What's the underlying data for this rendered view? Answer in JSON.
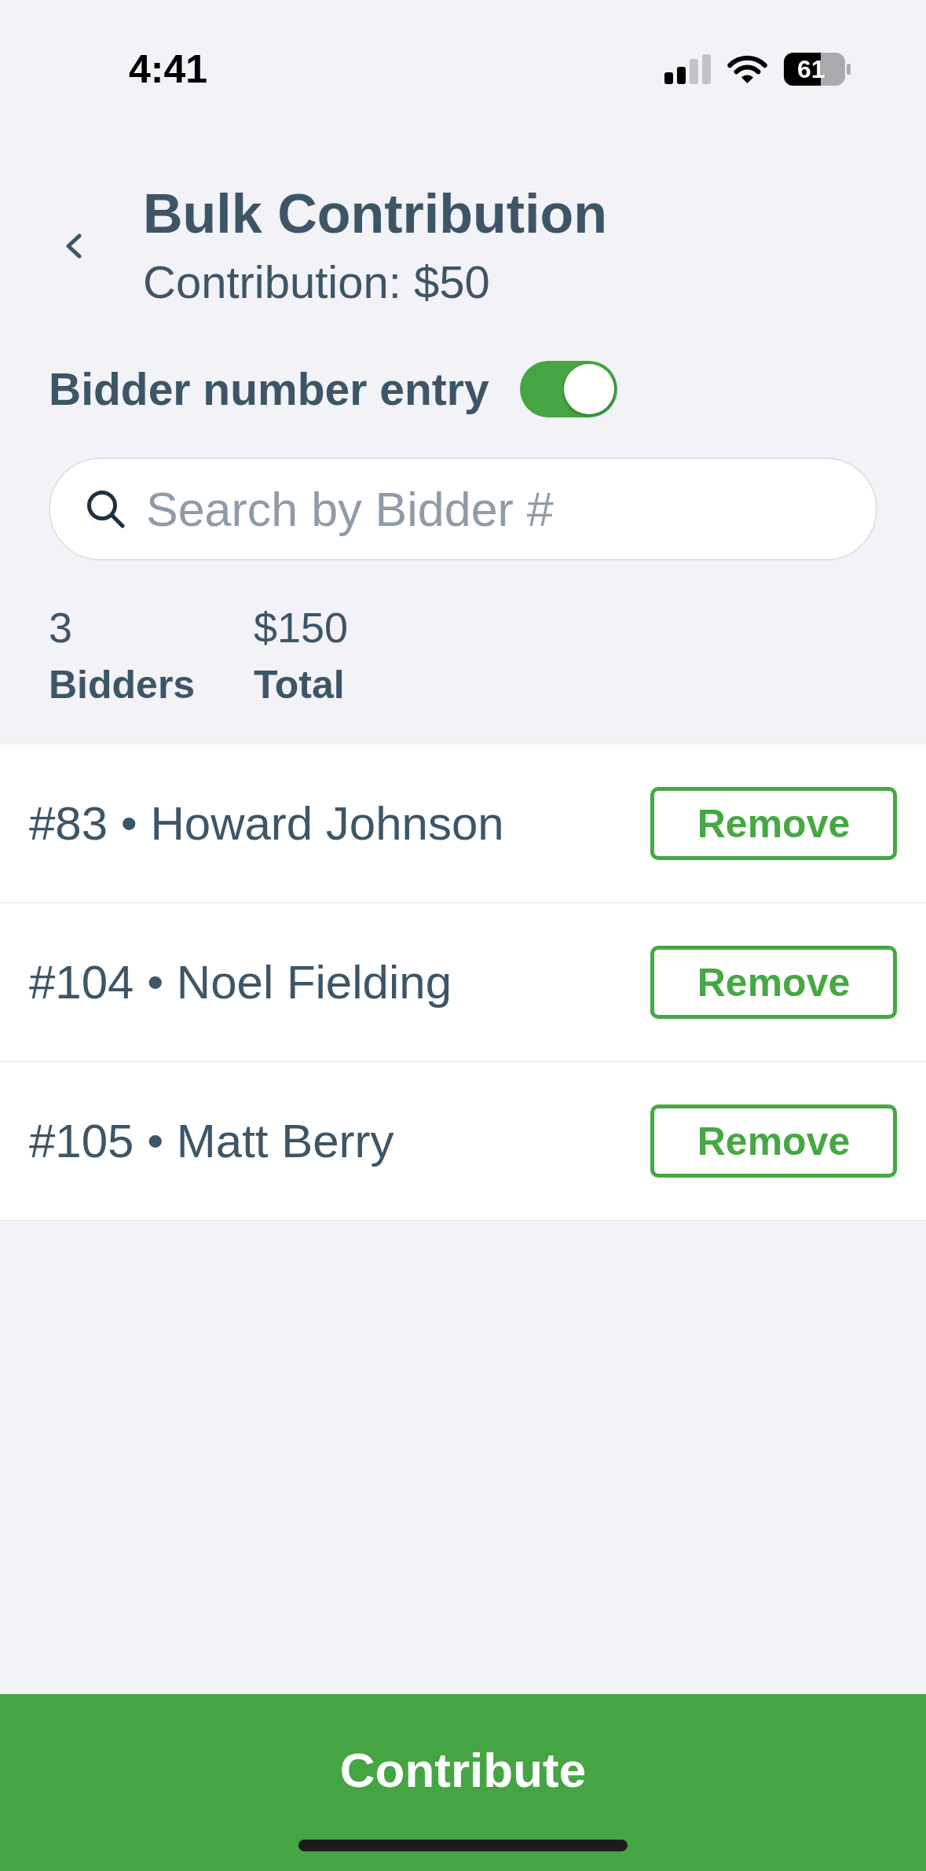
{
  "status_bar": {
    "time": "4:41",
    "battery": "61"
  },
  "header": {
    "title": "Bulk Contribution",
    "subtitle": "Contribution: $50"
  },
  "bidder_number_entry": {
    "label": "Bidder number entry",
    "on": true
  },
  "search": {
    "placeholder": "Search by Bidder #"
  },
  "stats": [
    {
      "value": "3",
      "label": "Bidders"
    },
    {
      "value": "$150",
      "label": "Total"
    }
  ],
  "bidders": [
    {
      "label": "#83 • Howard Johnson",
      "action": "Remove"
    },
    {
      "label": "#104 • Noel Fielding",
      "action": "Remove"
    },
    {
      "label": "#105 • Matt Berry",
      "action": "Remove"
    }
  ],
  "footer": {
    "button": "Contribute"
  }
}
